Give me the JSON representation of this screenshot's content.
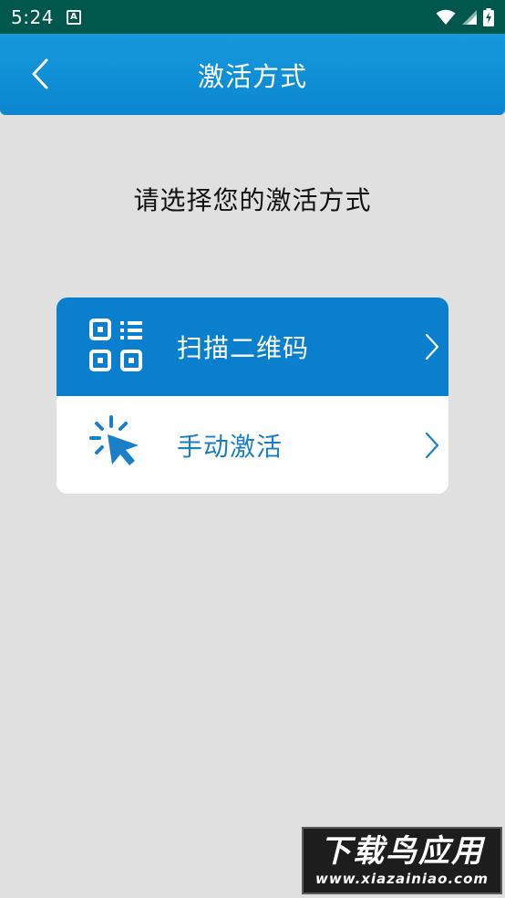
{
  "status_bar": {
    "time": "5:24",
    "notification_badge": "A",
    "icons": [
      "wifi-icon",
      "signal-icon",
      "battery-charging-icon"
    ]
  },
  "app_bar": {
    "title": "激活方式",
    "back_icon": "chevron-left-icon"
  },
  "prompt": "请选择您的激活方式",
  "options": [
    {
      "label": "扫描二维码",
      "icon": "qr-code-icon",
      "selected": true
    },
    {
      "label": "手动激活",
      "icon": "click-cursor-icon",
      "selected": false
    }
  ],
  "colors": {
    "status_bar": "#00574b",
    "app_bar": "#1799dc",
    "accent": "#0a7fcd",
    "background": "#e0e0e0"
  },
  "watermark": {
    "title": "下载鸟应用",
    "url": "www.xiazainiao.com"
  }
}
